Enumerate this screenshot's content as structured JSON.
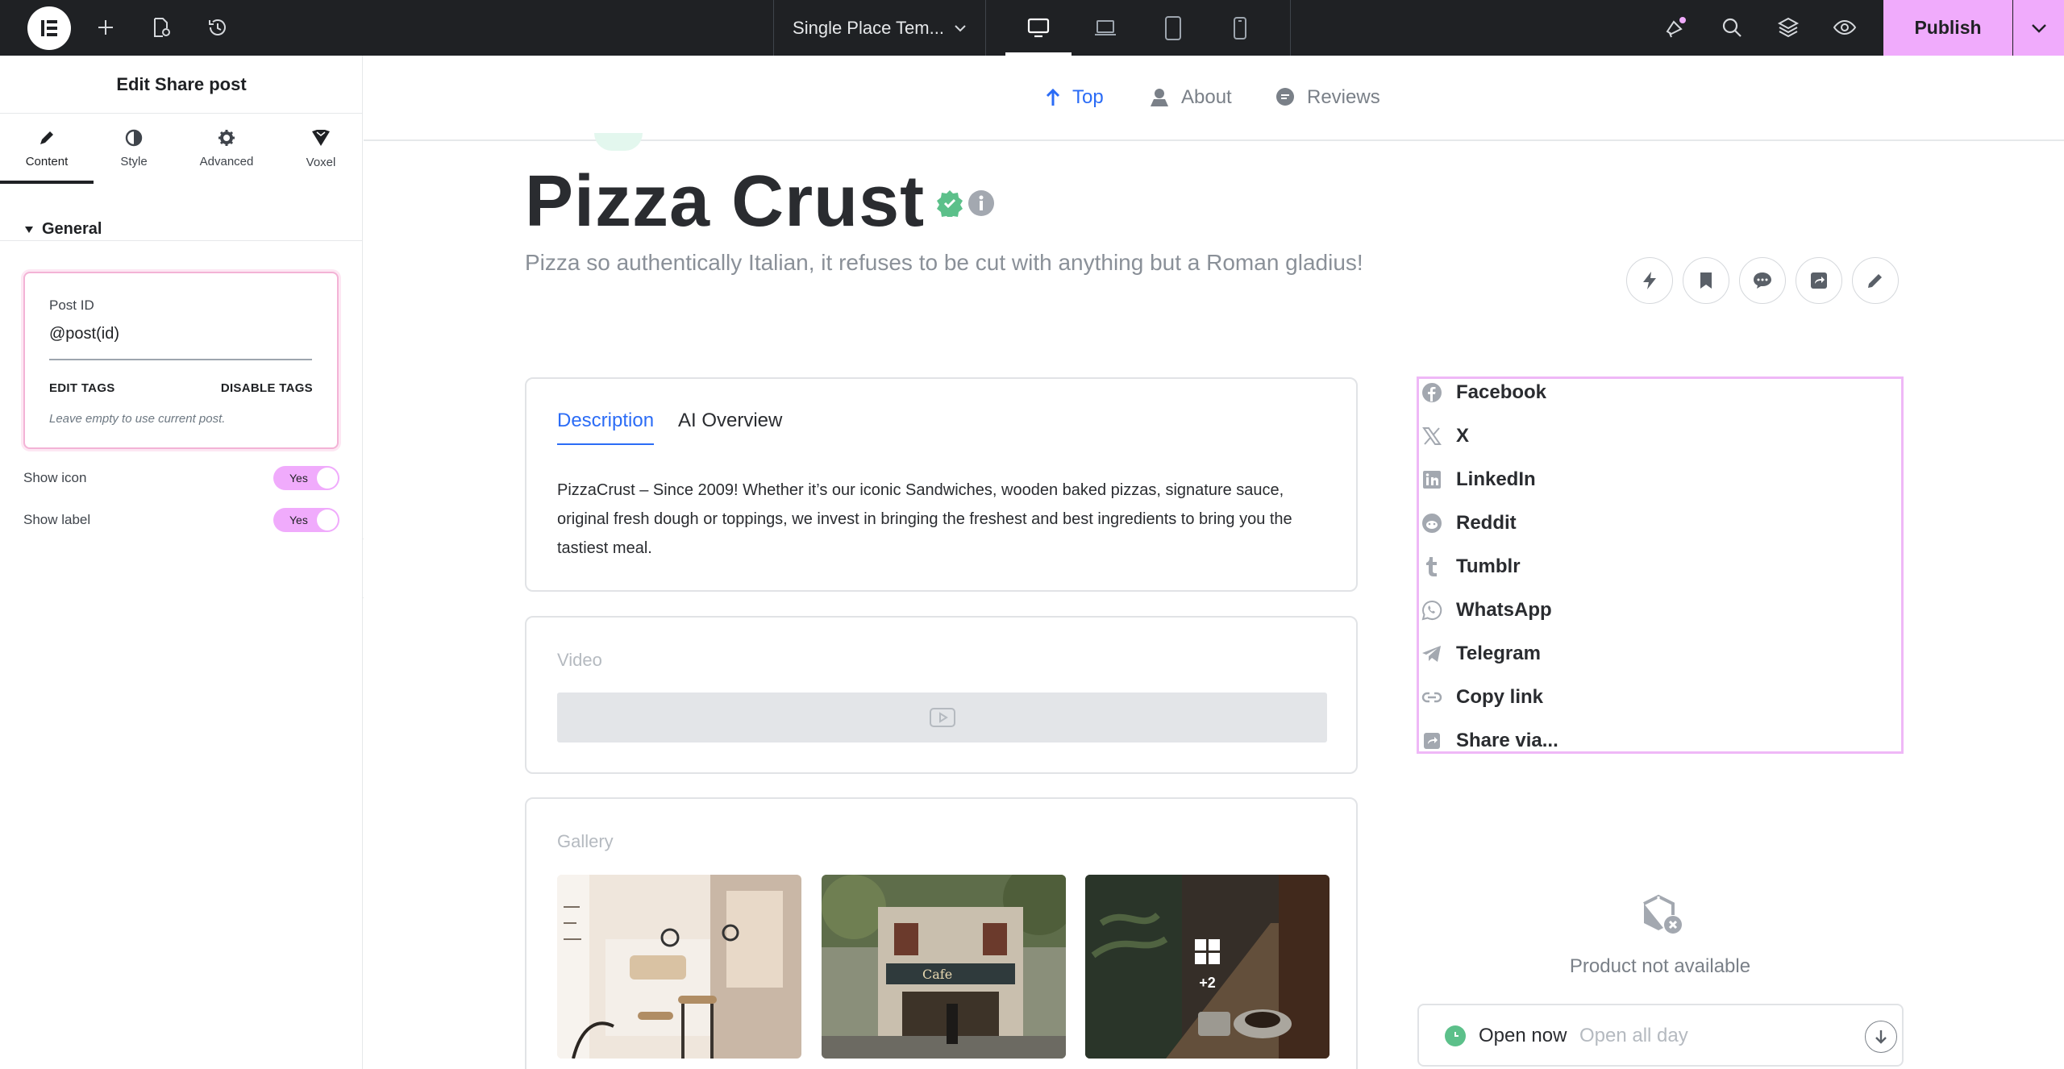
{
  "topbar": {
    "template_name": "Single Place Tem...",
    "publish_label": "Publish",
    "colors": {
      "bar": "#1f2124",
      "publish": "#f0abfc"
    },
    "icons": [
      "elementor-logo-icon",
      "add-icon",
      "page-settings-icon",
      "history-icon",
      "desktop-icon",
      "laptop-icon",
      "tablet-icon",
      "mobile-icon",
      "whats-new-icon",
      "search-icon",
      "structure-icon",
      "preview-eye-icon",
      "chevron-down-icon"
    ]
  },
  "panel": {
    "title": "Edit Share post",
    "tabs": [
      {
        "label": "Content",
        "icon": "pencil-icon"
      },
      {
        "label": "Style",
        "icon": "half-circle-icon"
      },
      {
        "label": "Advanced",
        "icon": "gear-icon"
      },
      {
        "label": "Voxel",
        "icon": "voxel-icon"
      }
    ],
    "section": "General",
    "post_id": {
      "label": "Post ID",
      "value": "@post(id)",
      "edit_tags": "EDIT TAGS",
      "disable_tags": "DISABLE TAGS",
      "hint": "Leave empty to use current post."
    },
    "controls": [
      {
        "label": "Show icon",
        "value": "Yes"
      },
      {
        "label": "Show label",
        "value": "Yes"
      }
    ]
  },
  "preview": {
    "nav": [
      {
        "label": "Top",
        "icon": "arrow-up-icon"
      },
      {
        "label": "About",
        "icon": "user-map-icon"
      },
      {
        "label": "Reviews",
        "icon": "chat-icon"
      }
    ],
    "title": "Pizza Crust",
    "subtitle": "Pizza so authentically Italian, it refuses to be cut with anything but a Roman gladius!",
    "actions": [
      "bolt-icon",
      "bookmark-icon",
      "message-icon",
      "share-icon",
      "edit-icon"
    ],
    "description_tabs": [
      "Description",
      "AI Overview"
    ],
    "description": "PizzaCrust – Since 2009! Whether it’s our iconic Sandwiches, wooden baked pizzas, signature sauce, original fresh dough or toppings, we invest in bringing the freshest and best ingredients to bring you the tastiest meal.",
    "video_label": "Video",
    "gallery_label": "Gallery",
    "gallery_more": "+2",
    "share_items": [
      {
        "label": "Facebook",
        "icon": "facebook-icon"
      },
      {
        "label": "X",
        "icon": "x-icon"
      },
      {
        "label": "LinkedIn",
        "icon": "linkedin-icon"
      },
      {
        "label": "Reddit",
        "icon": "reddit-icon"
      },
      {
        "label": "Tumblr",
        "icon": "tumblr-icon"
      },
      {
        "label": "WhatsApp",
        "icon": "whatsapp-icon"
      },
      {
        "label": "Telegram",
        "icon": "telegram-icon"
      },
      {
        "label": "Copy link",
        "icon": "link-icon"
      },
      {
        "label": "Share via...",
        "icon": "share-via-icon"
      }
    ],
    "product_unavailable": "Product not available",
    "open_status": "Open now",
    "open_hours": "Open all day"
  }
}
